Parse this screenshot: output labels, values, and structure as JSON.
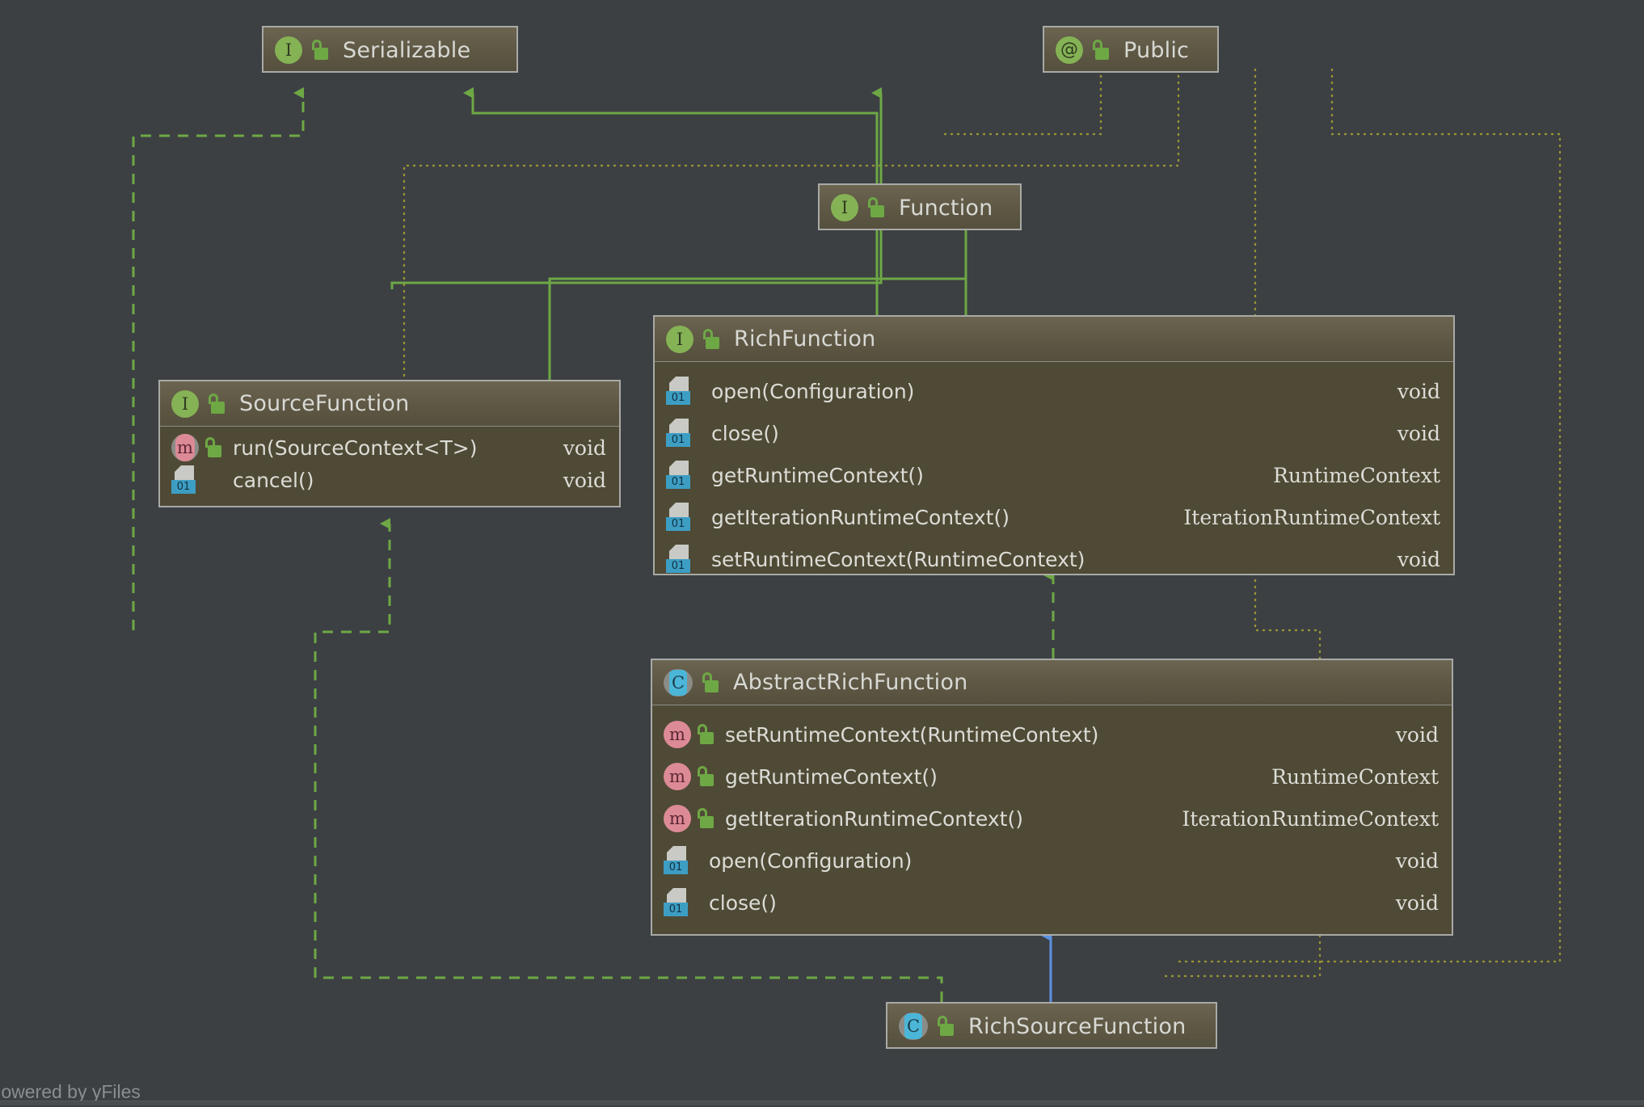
{
  "theme": {
    "background": "#3c4043",
    "node_body": "#4f4a35",
    "node_header_top": "#6b6450",
    "node_border": "#a9aaa6",
    "text": "#d8d9d4",
    "edge_implement": "#6ea845",
    "edge_extend": "#5b91e0",
    "edge_annotation": "#9a9433",
    "icon_interface": "#85b255",
    "icon_class": "#4bb6d8",
    "icon_method": "#dd8a97",
    "icon_abstract_tag": "#3d9ec4",
    "icon_lock": "#6ea845"
  },
  "diagram": {
    "type": "uml-class-diagram",
    "watermark": "Powered by yFiles"
  },
  "nodes": [
    {
      "id": "serializable",
      "name": "Serializable",
      "kind_icon": "interface-icon",
      "kind_letter": "I",
      "visibility_icon": "unlock-icon",
      "members": []
    },
    {
      "id": "public",
      "name": "Public",
      "kind_icon": "annotation-icon",
      "kind_letter": "@",
      "visibility_icon": "unlock-icon",
      "members": []
    },
    {
      "id": "function",
      "name": "Function",
      "kind_icon": "interface-icon",
      "kind_letter": "I",
      "visibility_icon": "unlock-icon",
      "members": []
    },
    {
      "id": "sourcefunction",
      "name": "SourceFunction",
      "kind_icon": "interface-icon",
      "kind_letter": "I",
      "visibility_icon": "unlock-icon",
      "members": [
        {
          "icon": "abstract-method-icon",
          "letter": "m",
          "lock": true,
          "name": "run(SourceContext<T>)",
          "type": "void"
        },
        {
          "icon": "abstract-doc-icon",
          "letter": "",
          "lock": false,
          "name": "cancel()",
          "type": "void"
        }
      ]
    },
    {
      "id": "richfunction",
      "name": "RichFunction",
      "kind_icon": "interface-icon",
      "kind_letter": "I",
      "visibility_icon": "unlock-icon",
      "members": [
        {
          "icon": "abstract-doc-icon",
          "letter": "",
          "lock": false,
          "name": "open(Configuration)",
          "type": "void"
        },
        {
          "icon": "abstract-doc-icon",
          "letter": "",
          "lock": false,
          "name": "close()",
          "type": "void"
        },
        {
          "icon": "abstract-doc-icon",
          "letter": "",
          "lock": false,
          "name": "getRuntimeContext()",
          "type": "RuntimeContext"
        },
        {
          "icon": "abstract-doc-icon",
          "letter": "",
          "lock": false,
          "name": "getIterationRuntimeContext()",
          "type": "IterationRuntimeContext"
        },
        {
          "icon": "abstract-doc-icon",
          "letter": "",
          "lock": false,
          "name": "setRuntimeContext(RuntimeContext)",
          "type": "void"
        }
      ]
    },
    {
      "id": "abstractrichfunction",
      "name": "AbstractRichFunction",
      "kind_icon": "class-icon",
      "kind_letter": "C",
      "visibility_icon": "unlock-icon",
      "members": [
        {
          "icon": "method-icon",
          "letter": "m",
          "lock": true,
          "name": "setRuntimeContext(RuntimeContext)",
          "type": "void"
        },
        {
          "icon": "method-icon",
          "letter": "m",
          "lock": true,
          "name": "getRuntimeContext()",
          "type": "RuntimeContext"
        },
        {
          "icon": "method-icon",
          "letter": "m",
          "lock": true,
          "name": "getIterationRuntimeContext()",
          "type": "IterationRuntimeContext"
        },
        {
          "icon": "abstract-doc-icon",
          "letter": "",
          "lock": false,
          "name": "open(Configuration)",
          "type": "void"
        },
        {
          "icon": "abstract-doc-icon",
          "letter": "",
          "lock": false,
          "name": "close()",
          "type": "void"
        }
      ]
    },
    {
      "id": "richsourcefunction",
      "name": "RichSourceFunction",
      "kind_icon": "class-icon",
      "kind_letter": "C",
      "visibility_icon": "unlock-icon",
      "members": []
    }
  ],
  "edges": [
    {
      "from": "sourcefunction",
      "to": "serializable",
      "style": "dashed",
      "color": "#6ea845",
      "relation": "implements"
    },
    {
      "from": "function",
      "to": "serializable",
      "style": "solid",
      "color": "#6ea845",
      "relation": "extends-interface"
    },
    {
      "from": "richfunction",
      "to": "serializable",
      "style": "solid",
      "color": "#6ea845",
      "relation": "extends-interface"
    },
    {
      "from": "sourcefunction",
      "to": "function",
      "style": "solid",
      "color": "#6ea845",
      "relation": "extends-interface"
    },
    {
      "from": "richfunction",
      "to": "function",
      "style": "solid",
      "color": "#6ea845",
      "relation": "extends-interface"
    },
    {
      "from": "abstractrichfunction",
      "to": "richfunction",
      "style": "dashed",
      "color": "#6ea845",
      "relation": "implements"
    },
    {
      "from": "richsourcefunction",
      "to": "sourcefunction",
      "style": "dashed",
      "color": "#6ea845",
      "relation": "implements"
    },
    {
      "from": "richsourcefunction",
      "to": "abstractrichfunction",
      "style": "solid",
      "color": "#5b91e0",
      "relation": "extends"
    },
    {
      "from": "public",
      "to": "function",
      "style": "dotted",
      "color": "#9a9433",
      "relation": "annotates"
    },
    {
      "from": "public",
      "to": "richfunction",
      "style": "dotted",
      "color": "#9a9433",
      "relation": "annotates"
    },
    {
      "from": "public",
      "to": "sourcefunction",
      "style": "dotted",
      "color": "#9a9433",
      "relation": "annotates"
    },
    {
      "from": "public",
      "to": "abstractrichfunction",
      "style": "dotted",
      "color": "#9a9433",
      "relation": "annotates"
    }
  ]
}
